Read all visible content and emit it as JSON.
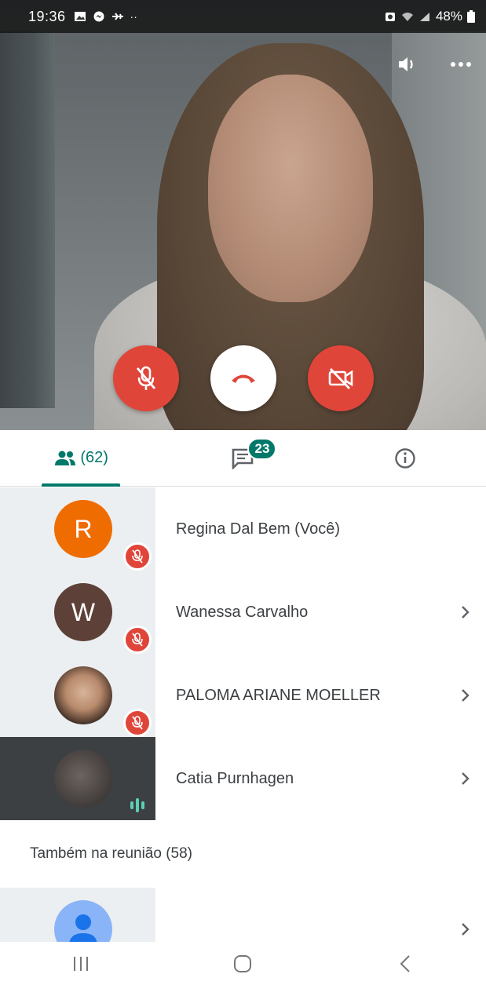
{
  "status_bar": {
    "time": "19:36",
    "battery": "48%",
    "left_icons": [
      "gallery-icon",
      "messenger-icon",
      "plane-icon",
      "dots-icon"
    ],
    "right_icons": [
      "alarm-icon",
      "wifi-icon",
      "signal-icon",
      "battery-icon"
    ]
  },
  "video": {
    "top_icons": [
      "speaker-icon",
      "more-options-icon"
    ]
  },
  "controls": {
    "mic": "mic-off-icon",
    "hangup": "hangup-icon",
    "camera": "camera-off-icon"
  },
  "tabs": {
    "people_count": "(62)",
    "chat_badge": "23",
    "info": "info-icon"
  },
  "participants": [
    {
      "initial": "R",
      "name": "Regina Dal Bem (Você)",
      "muted": true
    },
    {
      "initial": "W",
      "name": "Wanessa Carvalho",
      "muted": true
    },
    {
      "initial": "",
      "name": "PALOMA ARIANE MOELLER",
      "muted": true
    },
    {
      "initial": "",
      "name": "Catia Purnhagen",
      "speaking": true
    }
  ],
  "also_in_meeting": {
    "title": "Também na reunião (58)"
  },
  "colors": {
    "accent": "#00796b",
    "red": "#e0453a",
    "orange": "#ef6c00",
    "brown": "#5d4037"
  }
}
